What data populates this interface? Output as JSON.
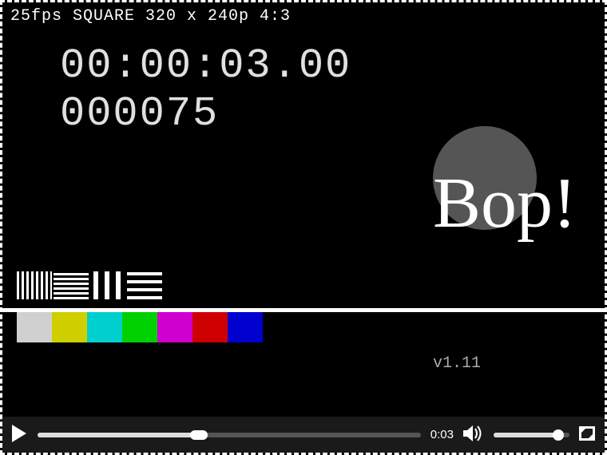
{
  "video": {
    "meta": "25fps SQUARE 320 x 240p 4:3",
    "timecode": "00:00:03.00",
    "framecount": "000075",
    "overlay_text": "Bop!",
    "version": "v1.11",
    "colorbars": [
      "#d0d0d0",
      "#cfcf00",
      "#00cfcf",
      "#00cf00",
      "#cf00cf",
      "#cf0000",
      "#0000cf"
    ]
  },
  "player": {
    "current_time": "0:03",
    "progress_percent": 42,
    "volume_percent": 85
  },
  "icons": {
    "play": "play-icon",
    "volume": "volume-icon",
    "fullscreen": "fullscreen-icon"
  }
}
